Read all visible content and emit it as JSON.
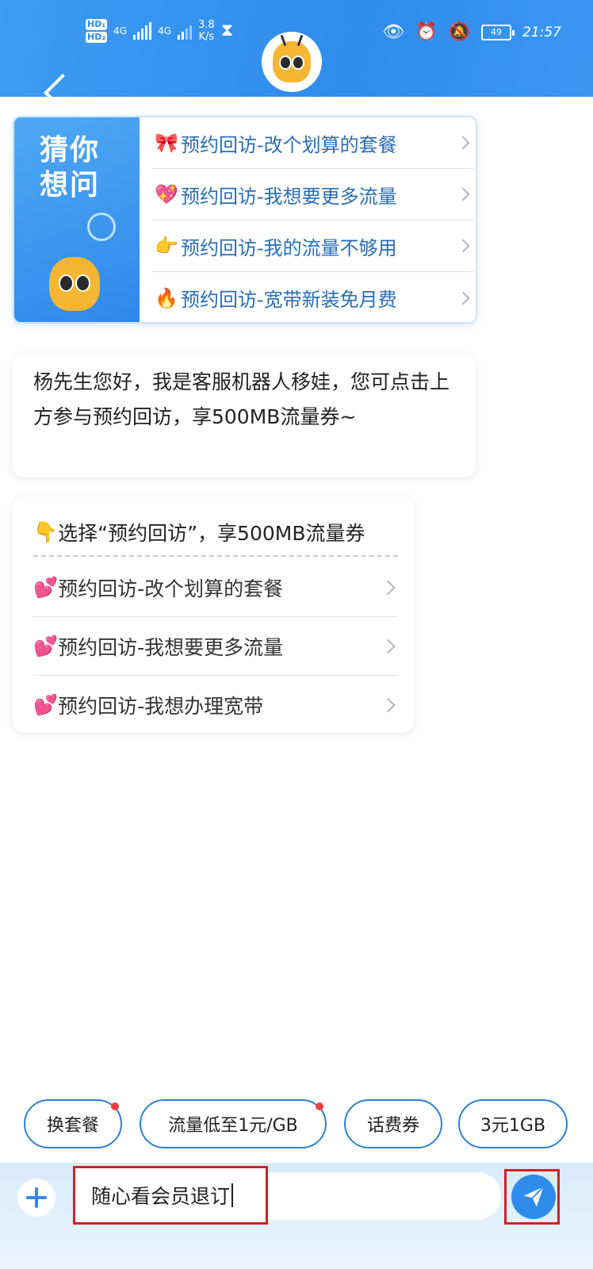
{
  "status_bar": {
    "hd1": "HD₁",
    "hd2": "HD₂",
    "net1": "4G",
    "net2": "4G",
    "speed_value": "3.8",
    "speed_unit": "K/s",
    "battery": "49",
    "time": "21:57"
  },
  "header": {
    "back_icon": "chevron-left-icon",
    "avatar_icon": "bee-mascot-avatar"
  },
  "guess_card": {
    "title": "猜你想问",
    "items": [
      {
        "icon": "🎀",
        "label": "预约回访-改个划算的套餐"
      },
      {
        "icon": "💖",
        "label": "预约回访-我想要更多流量"
      },
      {
        "icon": "👉",
        "label": "预约回访-我的流量不够用"
      },
      {
        "icon": "🔥",
        "label": "预约回访-宽带新装免月费"
      }
    ]
  },
  "greeting": {
    "text": "杨先生您好，我是客服机器人移娃，您可点击上方参与预约回访，享500MB流量券~"
  },
  "options_card": {
    "header_icon": "👇",
    "header": "选择“预约回访”，享500MB流量券",
    "items": [
      {
        "icon": "💕",
        "label": "预约回访-改个划算的套餐"
      },
      {
        "icon": "💕",
        "label": "预约回访-我想要更多流量"
      },
      {
        "icon": "💕",
        "label": "预约回访-我想办理宽带"
      }
    ]
  },
  "chips": [
    {
      "label": "换套餐",
      "badge": true
    },
    {
      "label": "流量低至1元/GB",
      "badge": true
    },
    {
      "label": "话费券",
      "badge": false
    },
    {
      "label": "3元1GB",
      "badge": false
    }
  ],
  "input": {
    "value": "随心看会员退订"
  },
  "colors": {
    "primary": "#2f8cec",
    "highlight_border": "#d42020",
    "badge": "#f04040"
  }
}
